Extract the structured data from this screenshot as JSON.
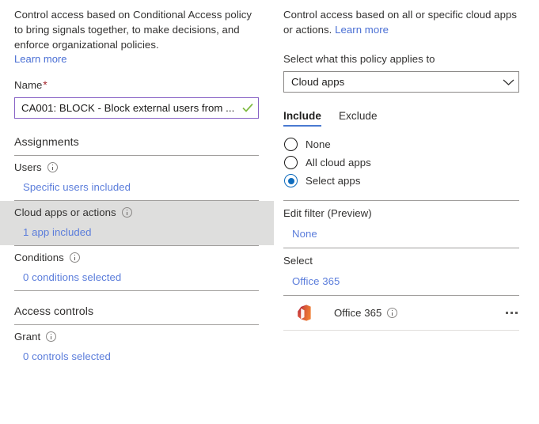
{
  "left_panel": {
    "intro_text": "Control access based on Conditional Access policy to bring signals together, to make decisions, and enforce organizational policies.",
    "intro_link": "Learn more",
    "name_label": "Name",
    "name_required_mark": "*",
    "name_value": "CA001: BLOCK - Block external users from ...",
    "name_valid_icon": "checkmark-icon",
    "assignments_heading": "Assignments",
    "access_controls_heading": "Access controls",
    "rows": [
      {
        "title": "Users",
        "info_icon": "info-icon",
        "value": "Specific users included",
        "selected": false
      },
      {
        "title": "Cloud apps or actions",
        "info_icon": "info-icon",
        "value": "1 app included",
        "selected": true
      },
      {
        "title": "Conditions",
        "info_icon": "info-icon",
        "value": "0 conditions selected",
        "selected": false
      }
    ],
    "grant_row": {
      "title": "Grant",
      "info_icon": "info-icon",
      "value": "0 controls selected"
    }
  },
  "right_panel": {
    "intro_text": "Control access based on all or specific cloud apps or actions.",
    "intro_link": "Learn more",
    "select_label": "Select what this policy applies to",
    "dropdown_value": "Cloud apps",
    "dropdown_icon": "chevron-down-icon",
    "tabs": [
      {
        "label": "Include",
        "active": true
      },
      {
        "label": "Exclude",
        "active": false
      }
    ],
    "radios": [
      {
        "label": "None",
        "checked": false
      },
      {
        "label": "All cloud apps",
        "checked": false
      },
      {
        "label": "Select apps",
        "checked": true
      }
    ],
    "edit_filter": {
      "label": "Edit filter (Preview)",
      "value": "None"
    },
    "select_section": {
      "label": "Select",
      "value": "Office 365"
    },
    "app_list": [
      {
        "icon": "office-365-icon",
        "name": "Office 365",
        "info_icon": "info-icon",
        "menu_icon": "ellipsis-icon"
      }
    ]
  },
  "colors": {
    "link": "#5b7ddb",
    "accent_blue": "#0f6cbd",
    "tab_underline": "#4a7ad1",
    "input_border_valid": "#8661c5",
    "required_red": "#a4262c",
    "checkmark_green": "#7fba42",
    "selected_row_bg": "#dededd",
    "divider": "#a19f9d",
    "office_icon_red": "#c43e1c",
    "office_icon_orange": "#eb6e24"
  }
}
